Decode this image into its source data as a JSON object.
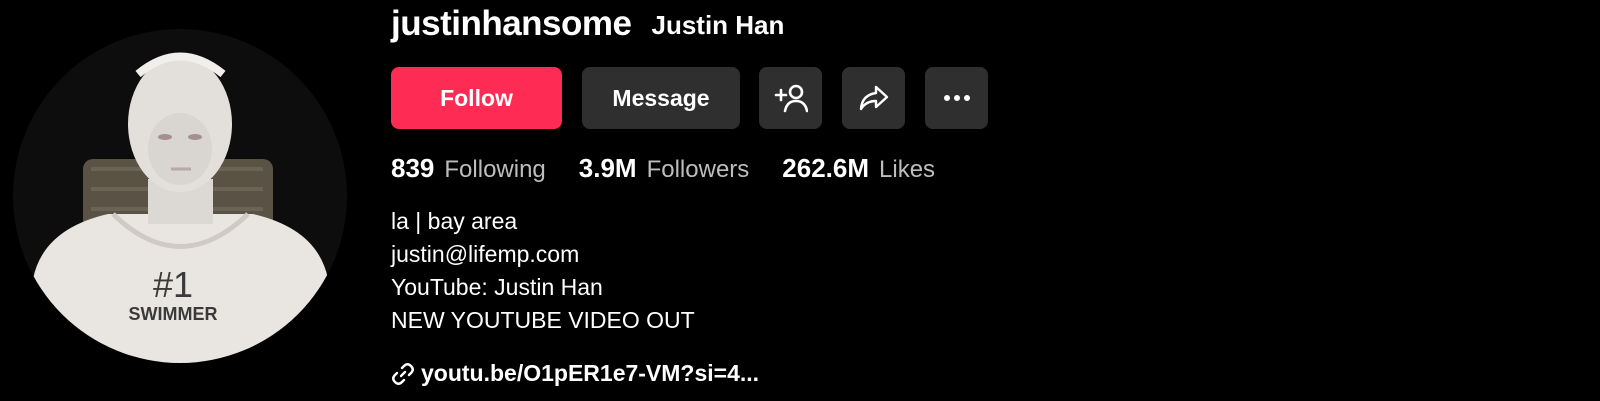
{
  "profile": {
    "username": "justinhansome",
    "display_name": "Justin Han",
    "avatar_icon": "profile-photo"
  },
  "actions": {
    "follow_label": "Follow",
    "message_label": "Message",
    "add_friend_icon": "add-friend-icon",
    "share_icon": "share-icon",
    "more_icon": "more-icon"
  },
  "stats": {
    "following_count": "839",
    "following_label": "Following",
    "followers_count": "3.9M",
    "followers_label": "Followers",
    "likes_count": "262.6M",
    "likes_label": "Likes"
  },
  "bio": {
    "lines": [
      "la | bay area",
      "justin@lifemp.com",
      "YouTube: Justin Han",
      "NEW YOUTUBE VIDEO OUT"
    ]
  },
  "link": {
    "text": "youtu.be/O1pER1e7-VM?si=4...",
    "icon": "link-icon"
  },
  "avatar_shirt_text": {
    "line1": "#1",
    "line2": "SWIMMER"
  },
  "colors": {
    "background": "#000000",
    "follow_button": "#fe2c55",
    "secondary_button": "#2f2f2f",
    "muted_text": "#bdbdbd"
  }
}
